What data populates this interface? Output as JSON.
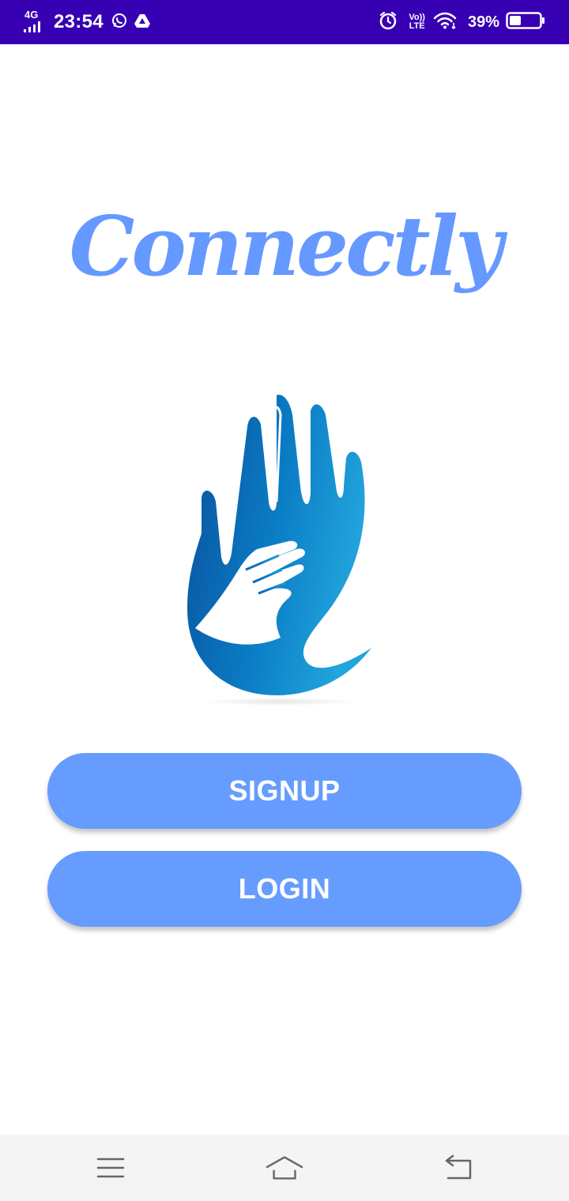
{
  "status_bar": {
    "network_type": "4G",
    "time": "23:54",
    "volte_top": "Vo))",
    "volte_bottom": "LTE",
    "battery_percent": "39%",
    "battery_level": 0.39,
    "icons": [
      "signal-icon",
      "whatsapp-icon",
      "drive-icon",
      "alarm-icon",
      "volte-icon",
      "wifi-icon",
      "battery-icon"
    ],
    "background_color": "#3700b3"
  },
  "brand": {
    "title": "Connectly",
    "color": "#6699ff"
  },
  "logo": {
    "icon": "hands-logo-icon",
    "colors": [
      "#0b5aa8",
      "#1e9ad8"
    ]
  },
  "buttons": {
    "signup_label": "SIGNUP",
    "login_label": "LOGIN",
    "color": "#669cfe"
  },
  "nav_bar": {
    "icons": [
      "menu-icon",
      "home-icon",
      "back-icon"
    ]
  }
}
